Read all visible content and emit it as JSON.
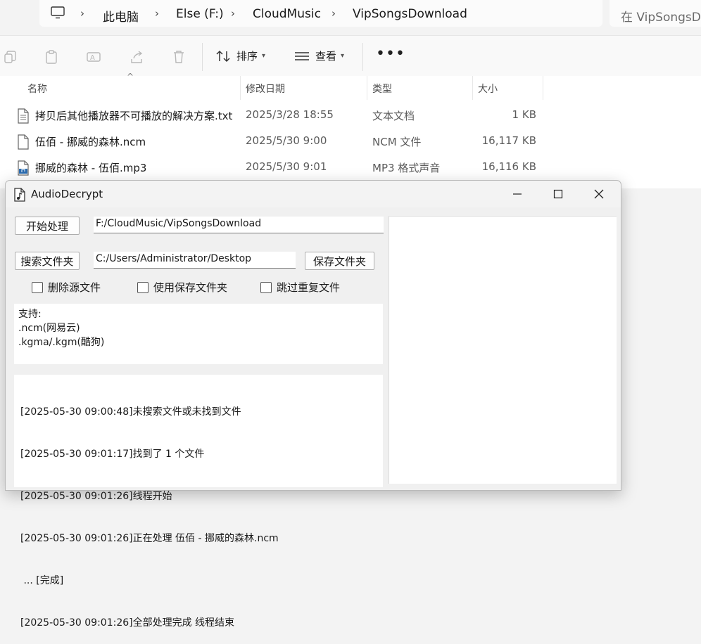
{
  "explorer": {
    "breadcrumb": [
      "此电脑",
      "Else (F:)",
      "CloudMusic",
      "VipSongsDownload"
    ],
    "search_placeholder": "在 VipSongsDownload 中搜索",
    "toolbar": {
      "sort_label": "排序",
      "view_label": "查看",
      "more_label": "•••"
    },
    "columns": {
      "name": "名称",
      "date": "修改日期",
      "type": "类型",
      "size": "大小"
    },
    "files": [
      {
        "name": "拷贝后其他播放器不可播放的解决方案.txt",
        "date": "2025/3/28 18:55",
        "type": "文本文档",
        "size": "1 KB",
        "icon": "text-file-icon"
      },
      {
        "name": "伍佰 - 挪威的森林.ncm",
        "date": "2025/5/30 9:00",
        "type": "NCM 文件",
        "size": "16,117 KB",
        "icon": "blank-file-icon"
      },
      {
        "name": "挪威的森林 - 伍佰.mp3",
        "date": "2025/5/30 9:01",
        "type": "MP3 格式声音",
        "size": "16,116 KB",
        "icon": "audio-file-icon"
      }
    ]
  },
  "app": {
    "title": "AudioDecrypt",
    "start_button": "开始处理",
    "source_path": "F:/CloudMusic/VipSongsDownload",
    "search_folder_button": "搜索文件夹",
    "save_path": "C:/Users/Administrator/Desktop",
    "save_folder_button": "保存文件夹",
    "checkboxes": [
      "删除源文件",
      "使用保存文件夹",
      "跳过重复文件"
    ],
    "support_lines": [
      "支持:",
      ".ncm(网易云)",
      ".kgma/.kgm(酷狗)"
    ],
    "log_lines": [
      "[2025-05-30 09:00:48]未搜索文件或未找到文件",
      "[2025-05-30 09:01:17]找到了 1 个文件",
      "[2025-05-30 09:01:26]线程开始",
      "[2025-05-30 09:01:26]正在处理 伍佰 - 挪威的森林.ncm",
      " ... [完成]",
      "[2025-05-30 09:01:26]全部处理完成 线程结束"
    ]
  }
}
